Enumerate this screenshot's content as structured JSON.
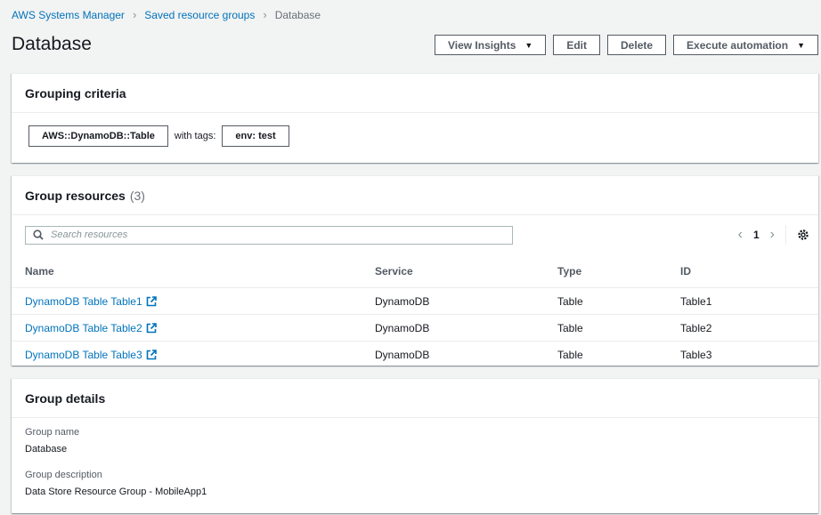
{
  "breadcrumb": {
    "items": [
      "AWS Systems Manager",
      "Saved resource groups"
    ],
    "current": "Database"
  },
  "page": {
    "title": "Database"
  },
  "actions": {
    "view_insights": "View Insights",
    "edit": "Edit",
    "delete": "Delete",
    "execute_automation": "Execute automation"
  },
  "criteria": {
    "title": "Grouping criteria",
    "resource_type": "AWS::DynamoDB::Table",
    "with_tags_label": "with tags:",
    "tag": "env: test"
  },
  "resources": {
    "title": "Group resources",
    "count": "(3)",
    "search_placeholder": "Search resources",
    "page": "1",
    "columns": [
      "Name",
      "Service",
      "Type",
      "ID"
    ],
    "rows": [
      {
        "name": "DynamoDB Table Table1",
        "service": "DynamoDB",
        "type": "Table",
        "id": "Table1"
      },
      {
        "name": "DynamoDB Table Table2",
        "service": "DynamoDB",
        "type": "Table",
        "id": "Table2"
      },
      {
        "name": "DynamoDB Table Table3",
        "service": "DynamoDB",
        "type": "Table",
        "id": "Table3"
      }
    ]
  },
  "details": {
    "title": "Group details",
    "group_name_label": "Group name",
    "group_name": "Database",
    "group_description_label": "Group description",
    "group_description": "Data Store Resource Group - MobileApp1"
  },
  "icons": [
    "chevron-right-icon",
    "caret-down-icon",
    "search-icon",
    "chevron-left-icon",
    "gear-icon",
    "external-link-icon"
  ],
  "colors": {
    "link": "#0073bb",
    "background": "#f2f3f3",
    "text": "#16191f"
  }
}
